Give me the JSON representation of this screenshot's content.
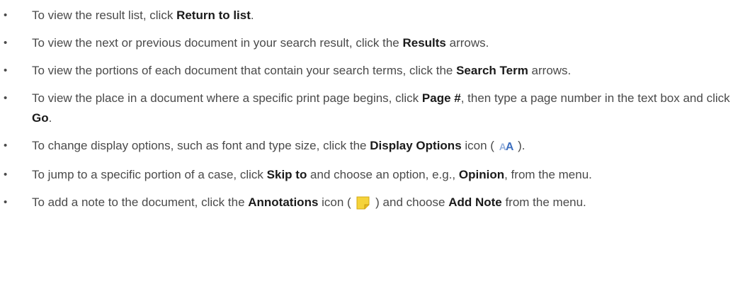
{
  "items": [
    {
      "parts": [
        {
          "t": "To view the result list, click "
        },
        {
          "t": "Return to list",
          "b": 1
        },
        {
          "t": "."
        }
      ]
    },
    {
      "parts": [
        {
          "t": "To view the next or previous document in your search result, click the "
        },
        {
          "t": "Results",
          "b": 1
        },
        {
          "t": " arrows."
        }
      ]
    },
    {
      "parts": [
        {
          "t": "To view the portions of each document that contain your search terms, click the "
        },
        {
          "t": "Search Term",
          "b": 1
        },
        {
          "t": " arrows."
        }
      ]
    },
    {
      "parts": [
        {
          "t": "To view the place in a document where a specific print page begins, click "
        },
        {
          "t": "Page #",
          "b": 1
        },
        {
          "t": ", then type a page number in the text box and click "
        },
        {
          "t": "Go",
          "b": 1
        },
        {
          "t": "."
        }
      ]
    },
    {
      "parts": [
        {
          "t": "To change display options, such as font and type size, click the "
        },
        {
          "t": "Display Options",
          "b": 1
        },
        {
          "t": " icon ( "
        },
        {
          "icon": "display-options-icon"
        },
        {
          "t": " )."
        }
      ]
    },
    {
      "parts": [
        {
          "t": "To jump to a specific portion of a case, click "
        },
        {
          "t": "Skip to",
          "b": 1
        },
        {
          "t": " and choose an option, e.g., "
        },
        {
          "t": "Opinion",
          "b": 1
        },
        {
          "t": ", from the menu."
        }
      ]
    },
    {
      "parts": [
        {
          "t": "To add a note to the document, click the "
        },
        {
          "t": "Annotations",
          "b": 1
        },
        {
          "t": " icon ( "
        },
        {
          "icon": "annotations-icon"
        },
        {
          "t": " ) and choose "
        },
        {
          "t": "Add Note",
          "b": 1
        },
        {
          "t": " from the menu."
        }
      ]
    }
  ],
  "bullet_char": "•",
  "colors": {
    "text": "#4a4a4a",
    "strong": "#1a1a1a",
    "display_icon": "#3d6fbf",
    "note_icon": "#f5d33a"
  }
}
